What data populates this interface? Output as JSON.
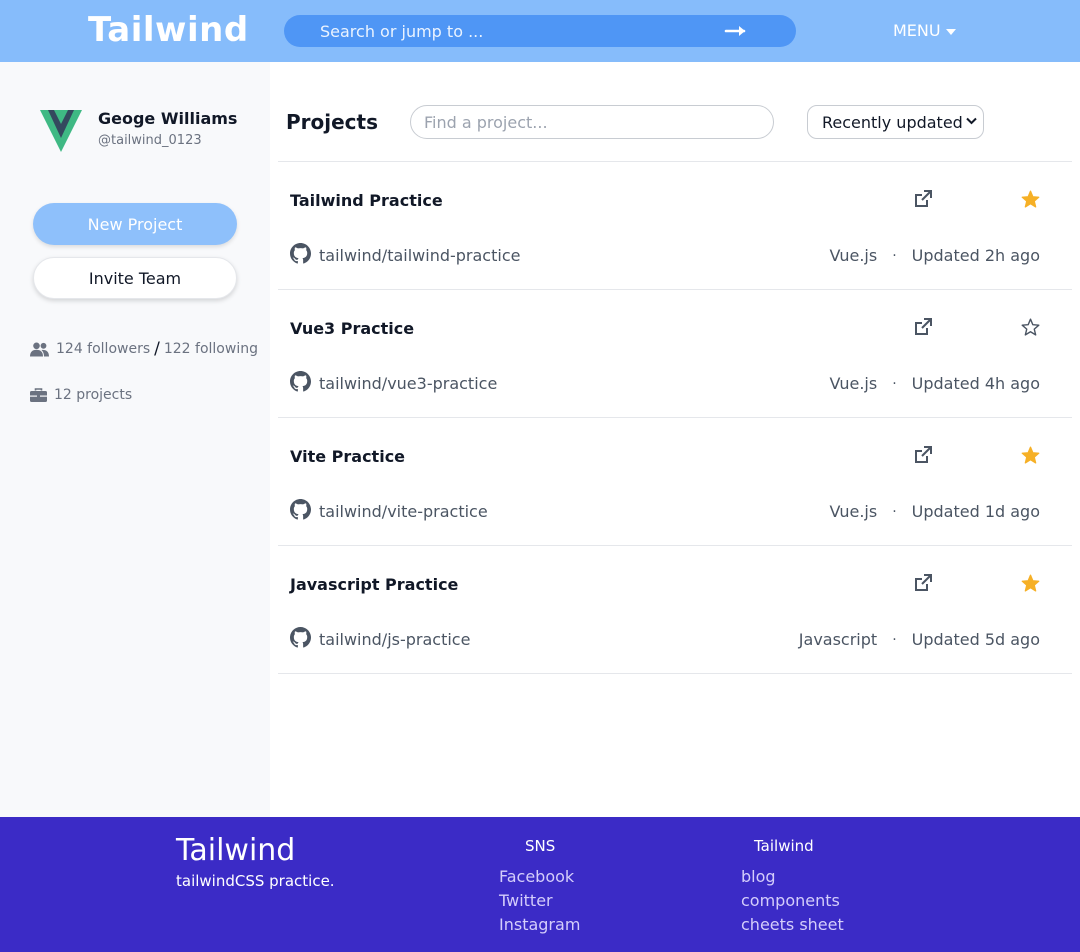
{
  "header": {
    "brand": "Tailwind",
    "search_placeholder": "Search or jump to ...",
    "menu_label": "MENU"
  },
  "profile": {
    "name": "Geoge Williams",
    "handle": "@tailwind_0123",
    "new_project_label": "New Project",
    "invite_label": "Invite Team",
    "followers": "124 followers",
    "following": "122 following",
    "projects": "12 projects"
  },
  "main": {
    "title": "Projects",
    "find_placeholder": "Find a project...",
    "sort_selected": "Recently updated",
    "projects": [
      {
        "name": "Tailwind Practice",
        "repo": "tailwind/tailwind-practice",
        "language": "Vue.js",
        "updated": "Updated 2h ago",
        "starred": true
      },
      {
        "name": "Vue3 Practice",
        "repo": "tailwind/vue3-practice",
        "language": "Vue.js",
        "updated": "Updated 4h ago",
        "starred": false
      },
      {
        "name": "Vite Practice",
        "repo": "tailwind/vite-practice",
        "language": "Vue.js",
        "updated": "Updated 1d ago",
        "starred": true
      },
      {
        "name": "Javascript Practice",
        "repo": "tailwind/js-practice",
        "language": "Javascript",
        "updated": "Updated 5d ago",
        "starred": true
      }
    ]
  },
  "footer": {
    "brand": "Tailwind",
    "tagline": "tailwindCSS practice.",
    "sns_title": "SNS",
    "sns_links": [
      "Facebook",
      "Twitter",
      "Instagram"
    ],
    "tw_title": "Tailwind",
    "tw_links": [
      "blog",
      "components",
      "cheets sheet"
    ]
  },
  "colors": {
    "header_bg": "#86bcfb",
    "search_bg": "#4f96f5",
    "accent_button": "#8ec0fb",
    "star_filled": "#f6b026",
    "footer_bg": "#3b2bc6"
  },
  "icons": {
    "search_submit": "arrow-right-icon",
    "menu_caret": "caret-down-icon",
    "followers": "users-icon",
    "projects": "briefcase-icon",
    "open_link": "external-link-icon",
    "star": "star-icon",
    "repo": "github-icon"
  }
}
